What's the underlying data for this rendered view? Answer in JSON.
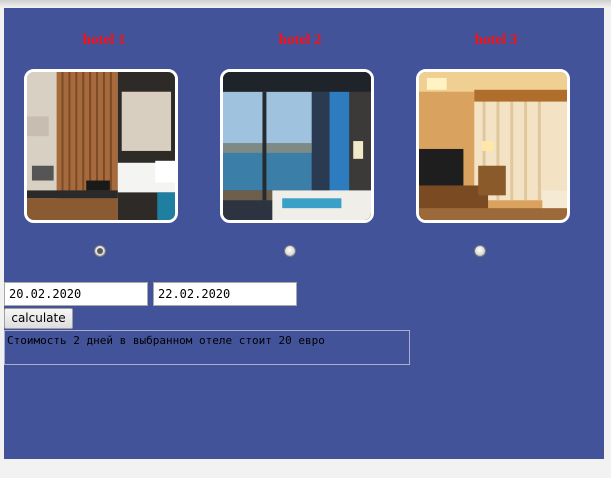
{
  "hotels": [
    {
      "title": "hotel 1",
      "selected": true
    },
    {
      "title": "hotel 2",
      "selected": false
    },
    {
      "title": "hotel 3",
      "selected": false
    }
  ],
  "form": {
    "date_from": "20.02.2020",
    "date_to": "22.02.2020",
    "calculate_label": "calculate",
    "result_text": "Стоимость 2 дней в выбранном отеле стоит 20 евро"
  },
  "colors": {
    "panel_bg": "#42539a",
    "title_color": "#ff1010"
  }
}
